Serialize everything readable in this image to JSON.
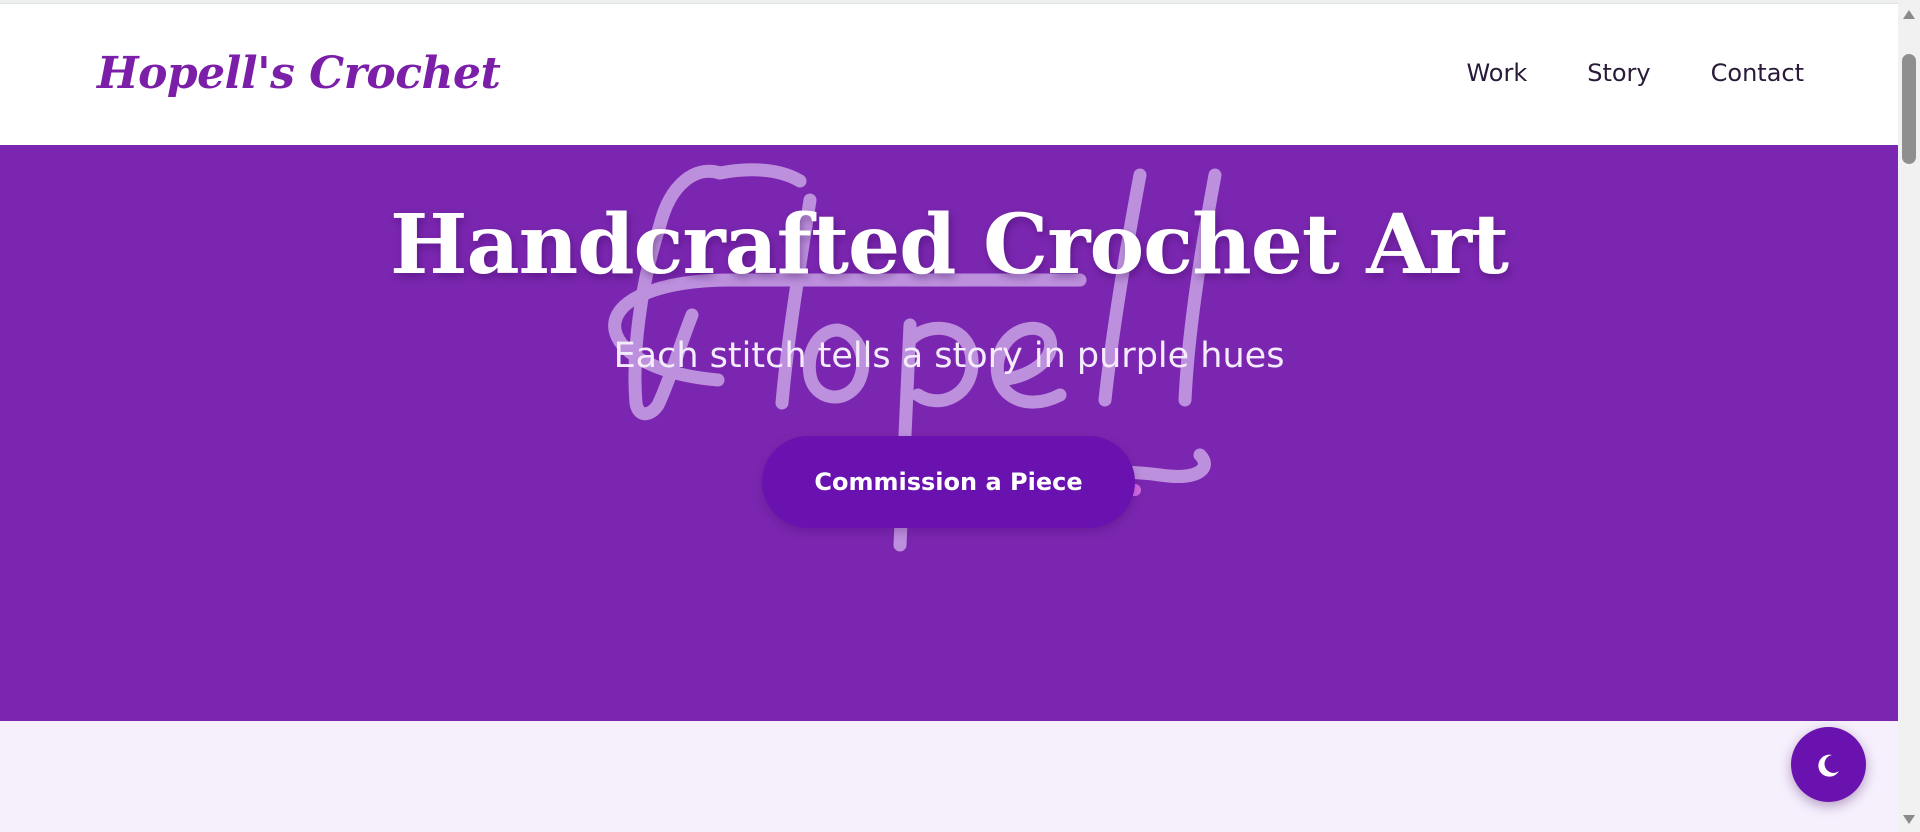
{
  "header": {
    "logo": "Hopell's Crochet",
    "nav": [
      {
        "label": "Work"
      },
      {
        "label": "Story"
      },
      {
        "label": "Contact"
      }
    ]
  },
  "hero": {
    "title": "Handcrafted Crochet Art",
    "subtitle": "Each stitch tells a story in purple hues",
    "cta_label": "Commission a Piece",
    "watermark_text": "Hopell"
  },
  "theme_toggle": {
    "icon": "moon-icon"
  },
  "colors": {
    "brand_purple": "#7b1fa8",
    "hero_bg": "#7b26b0",
    "button_purple": "#6a12b0",
    "section_bg": "#f6f0fd"
  }
}
